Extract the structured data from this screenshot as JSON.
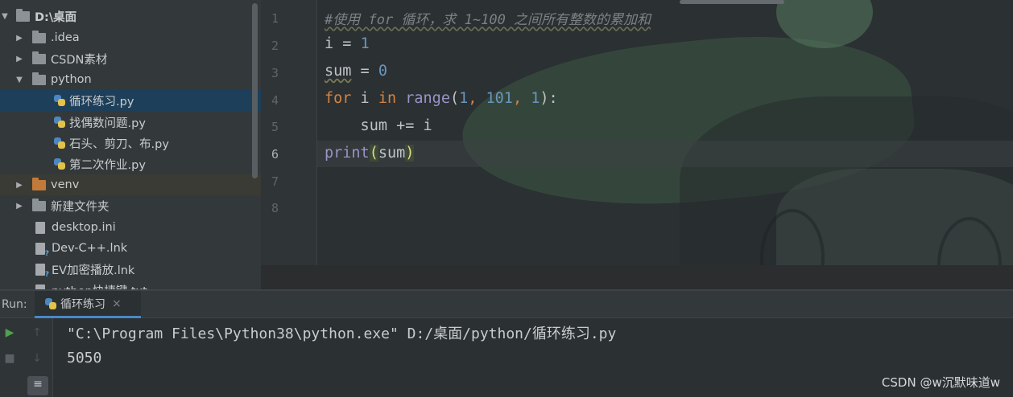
{
  "project_tree": {
    "root": "D:\\桌面",
    "items": [
      {
        "label": ".idea",
        "type": "folder",
        "expanded": false
      },
      {
        "label": "CSDN素材",
        "type": "folder",
        "expanded": false
      },
      {
        "label": "python",
        "type": "folder",
        "expanded": true
      },
      {
        "label": "循环练习.py",
        "type": "python",
        "selected": true
      },
      {
        "label": "找偶数问题.py",
        "type": "python"
      },
      {
        "label": "石头、剪刀、布.py",
        "type": "python"
      },
      {
        "label": "第二次作业.py",
        "type": "python"
      },
      {
        "label": "venv",
        "type": "folder-orange",
        "expanded": false
      },
      {
        "label": "新建文件夹",
        "type": "folder",
        "expanded": false
      },
      {
        "label": "desktop.ini",
        "type": "file"
      },
      {
        "label": "Dev-C++.lnk",
        "type": "link"
      },
      {
        "label": "EV加密播放.lnk",
        "type": "link"
      },
      {
        "label": "python快捷键.txt",
        "type": "file"
      }
    ]
  },
  "editor": {
    "line_numbers": [
      "1",
      "2",
      "3",
      "4",
      "5",
      "6",
      "7",
      "8"
    ],
    "current_line": 6,
    "lines": [
      {
        "comment": "#使用 for 循环，求 1~100 之间所有整数的累加和"
      },
      {
        "a": "i = ",
        "num": "1"
      },
      {
        "var": "sum",
        "op": " = ",
        "num": "0"
      },
      {
        "kw1": "for",
        "t1": " i ",
        "kw2": "in",
        "t2": " ",
        "fn": "range",
        "t3": "(",
        "n1": "1",
        "c1": ", ",
        "n2": "101",
        "c2": ", ",
        "n3": "1",
        "t4": "):"
      },
      {
        "text": "    sum += i"
      },
      {
        "fn": "print",
        "lp": "(",
        "arg": "sum",
        "rp": ")"
      }
    ]
  },
  "run": {
    "label": "Run:",
    "tab_label": "循环练习",
    "close": "×",
    "output": [
      "\"C:\\Program Files\\Python38\\python.exe\" D:/桌面/python/循环练习.py",
      "5050"
    ]
  },
  "watermark": "CSDN @w沉默味道w",
  "colors": {
    "selection": "#1e3f5a",
    "keyword": "#d28445",
    "number": "#6996bb",
    "builtin": "#9a93c8",
    "run_green": "#4fa14f"
  },
  "icons": {
    "expand": "triangle-right",
    "collapse": "triangle-down",
    "run": "play-icon",
    "stop": "stop-icon",
    "up": "arrow-up-icon",
    "down": "arrow-down-icon",
    "wrap": "soft-wrap-icon"
  }
}
